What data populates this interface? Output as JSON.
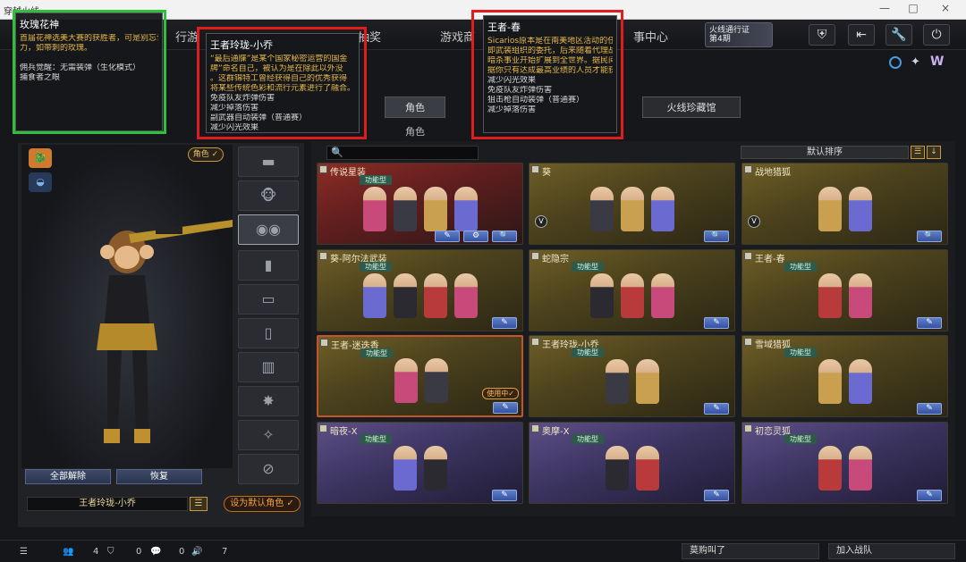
{
  "window": {
    "title": "穿越火线",
    "min": "—",
    "max": "□",
    "close": "×"
  },
  "nav": {
    "items": [
      "行游",
      "抽奖",
      "游戏商",
      "事中心"
    ],
    "pass": {
      "line1": "火线通行证",
      "line2": "第4期"
    },
    "icons": [
      "shield-icon",
      "exit-icon",
      "wrench-icon",
      "power-icon"
    ]
  },
  "subtabs": {
    "role": "角色",
    "role2": "角色",
    "museum": "火线珍藏馆"
  },
  "left": {
    "role_tag": "角色 ✓",
    "unequip_all": "全部解除",
    "restore": "恢复",
    "current_name": "王者玲珑-小乔",
    "set_default": "设为默认角色 ✓",
    "slot_labels": [
      "rifle",
      "monkey-head",
      "goggles",
      "radio",
      "vest",
      "backpack",
      "ammo",
      "gold-weapon",
      "silver-weapon",
      "locked"
    ]
  },
  "right": {
    "search_placeholder": "",
    "sort": "默认排序",
    "cards": [
      {
        "title": "传说星装",
        "badge": "功能型",
        "theme": "red",
        "figs": 4,
        "tools": [
          "✎",
          "⚙",
          "🔍"
        ]
      },
      {
        "title": "葵",
        "badge": "",
        "theme": "gold",
        "figs": 3,
        "tools": [
          "🔍"
        ],
        "v": "V"
      },
      {
        "title": "战地猎狐",
        "badge": "",
        "theme": "gold",
        "figs": 2,
        "tools": [
          "🔍"
        ],
        "v": "V"
      },
      {
        "title": "葵-阿尔法武装",
        "badge": "功能型",
        "theme": "gold",
        "figs": 4,
        "tools": [
          "✎"
        ]
      },
      {
        "title": "蛇隐宗",
        "badge": "功能型",
        "theme": "gold",
        "figs": 3,
        "tools": [
          "✎"
        ]
      },
      {
        "title": "王者-春",
        "badge": "功能型",
        "theme": "gold",
        "figs": 2,
        "tools": [
          "✎"
        ]
      },
      {
        "title": "王者-迷迭香",
        "badge": "功能型",
        "theme": "gold",
        "figs": 2,
        "tools": [
          "✎"
        ],
        "inuse": "使用中✓",
        "active": true
      },
      {
        "title": "王者玲珑-小乔",
        "badge": "功能型",
        "theme": "gold",
        "figs": 2,
        "tools": [
          "✎"
        ]
      },
      {
        "title": "雪域猎狐",
        "badge": "功能型",
        "theme": "gold",
        "figs": 2,
        "tools": [
          "✎"
        ]
      },
      {
        "title": "暗夜-X",
        "badge": "功能型",
        "theme": "purple",
        "figs": 2,
        "tools": [
          "✎"
        ]
      },
      {
        "title": "奥摩-X",
        "badge": "功能型",
        "theme": "purple",
        "figs": 2,
        "tools": [
          "✎"
        ]
      },
      {
        "title": "初恋灵狐",
        "badge": "功能型",
        "theme": "purple",
        "figs": 2,
        "tools": [
          "✎"
        ]
      }
    ]
  },
  "tooltips": {
    "rose": {
      "title": "玫瑰花神",
      "lines": [
        "首届花神选美大赛的获胜者，可是别忘记",
        "力，如带刺的玫瑰。",
        "",
        "佣兵觉醒：无需装弹（生化模式）",
        "捕食者之眼"
      ]
    },
    "xiaoqiao": {
      "title": "王者玲珑-小乔",
      "lines": [
        "“最后通牒”是某个国家秘密运营的国金",
        "牌”命名自己，被认为是在除此以外没",
        "。这群锦特工曾经获得自己的优秀获得",
        "将某些传统色彩和流行元素进行了融合。",
        "免疫队友炸弹伤害",
        "减少掉落伤害",
        "副武器自动装弹（普通赛）",
        "减少闪光效果"
      ]
    },
    "chun": {
      "title": "王者-春",
      "lines": [
        "Sicarios原本是在南美地区活动的任务成",
        "即武装组织的委托，后来随着代理战争",
        "暗杀事业开始扩展到全世界。据民间传闻",
        "据你只有达成最高业绩的人员才能获得",
        "减少闪光效果",
        "免疫队友炸弹伤害",
        "狙击枪自动装弹（普通赛）",
        "减少掉落伤害"
      ]
    }
  },
  "bottom": {
    "friends": "4",
    "guild": "0",
    "chat": "0",
    "vol": "7",
    "msg": "莫购叫了",
    "join": "加入战队"
  }
}
